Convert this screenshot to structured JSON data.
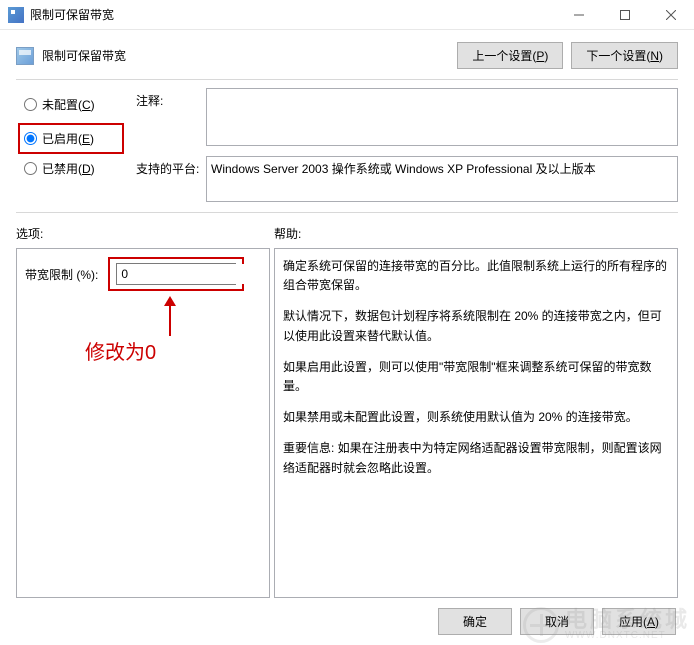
{
  "window": {
    "title": "限制可保留带宽"
  },
  "header": {
    "title": "限制可保留带宽",
    "prev": "上一个设置(",
    "prev_key": "P",
    "prev_close": ")",
    "next": "下一个设置(",
    "next_key": "N",
    "next_close": ")"
  },
  "radios": {
    "not_configured": "未配置(",
    "not_configured_key": "C",
    "not_configured_close": ")",
    "enabled": "已启用(",
    "enabled_key": "E",
    "enabled_close": ")",
    "disabled": "已禁用(",
    "disabled_key": "D",
    "disabled_close": ")"
  },
  "fields": {
    "comment_label": "注释:",
    "comment_value": "",
    "platform_label": "支持的平台:",
    "platform_value": "Windows Server 2003 操作系统或 Windows XP Professional 及以上版本"
  },
  "labels": {
    "options": "选项:",
    "help": "帮助:"
  },
  "options": {
    "bw_label": "带宽限制 (%):",
    "bw_value": "0"
  },
  "help": {
    "p1": "确定系统可保留的连接带宽的百分比。此值限制系统上运行的所有程序的组合带宽保留。",
    "p2": "默认情况下，数据包计划程序将系统限制在 20% 的连接带宽之内，但可以使用此设置来替代默认值。",
    "p3": "如果启用此设置，则可以使用\"带宽限制\"框来调整系统可保留的带宽数量。",
    "p4": "如果禁用或未配置此设置，则系统使用默认值为 20% 的连接带宽。",
    "p5": "重要信息: 如果在注册表中为特定网络适配器设置带宽限制，则配置该网络适配器时就会忽略此设置。"
  },
  "annotation": {
    "text": "修改为0"
  },
  "footer": {
    "ok": "确定",
    "cancel": "取消",
    "apply": "应用(",
    "apply_key": "A",
    "apply_close": ")"
  },
  "watermark": {
    "cn": "电脑系统城",
    "en": "WWW.DNXTC.NET"
  }
}
